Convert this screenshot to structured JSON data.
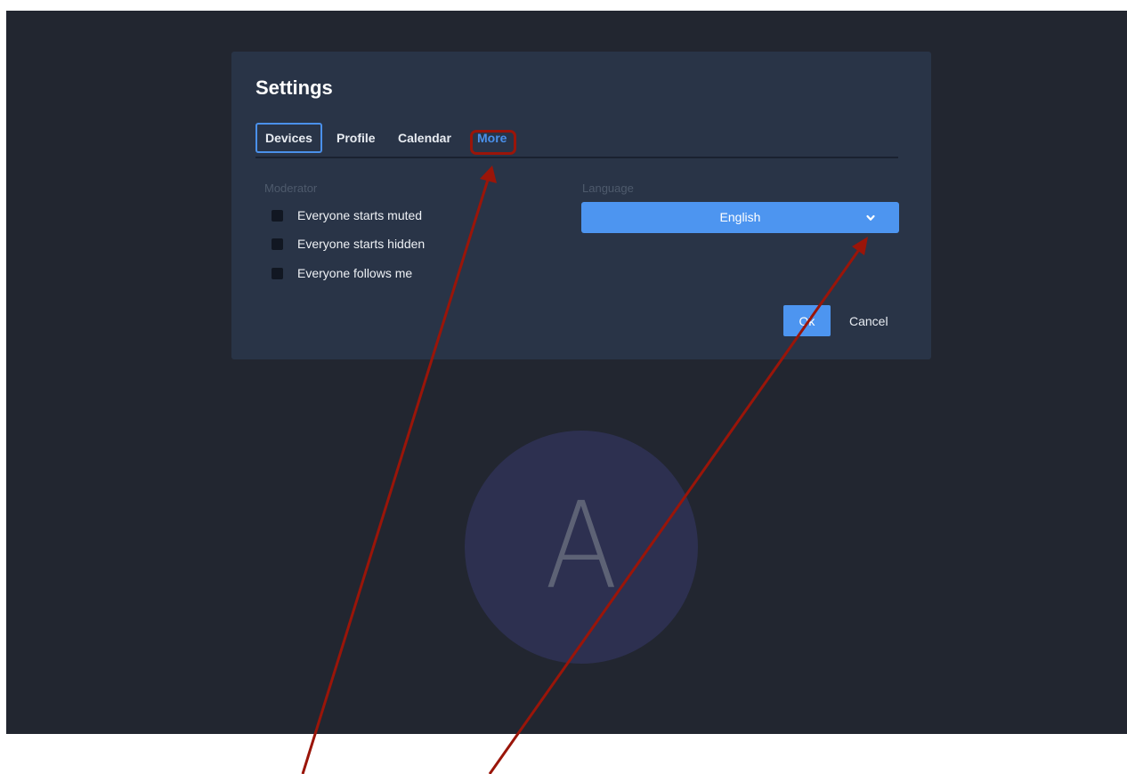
{
  "dialog": {
    "title": "Settings",
    "tabs": [
      {
        "label": "Devices",
        "state": "focused"
      },
      {
        "label": "Profile"
      },
      {
        "label": "Calendar"
      },
      {
        "label": "More",
        "state": "active"
      }
    ],
    "moderator": {
      "heading": "Moderator",
      "options": [
        {
          "label": "Everyone starts muted",
          "checked": false
        },
        {
          "label": "Everyone starts hidden",
          "checked": false
        },
        {
          "label": "Everyone follows me",
          "checked": false
        }
      ]
    },
    "language": {
      "heading": "Language",
      "selected": "English"
    },
    "ok_label": "Ok",
    "cancel_label": "Cancel"
  },
  "avatar": {
    "letter": "A"
  },
  "icons": {
    "language_dropdown": "chevron-down-icon"
  },
  "colors": {
    "background": "#222630",
    "dialog": "#293447",
    "accent": "#4d95f0",
    "annotation": "#9a1509",
    "avatar_circle": "#2d3050"
  }
}
